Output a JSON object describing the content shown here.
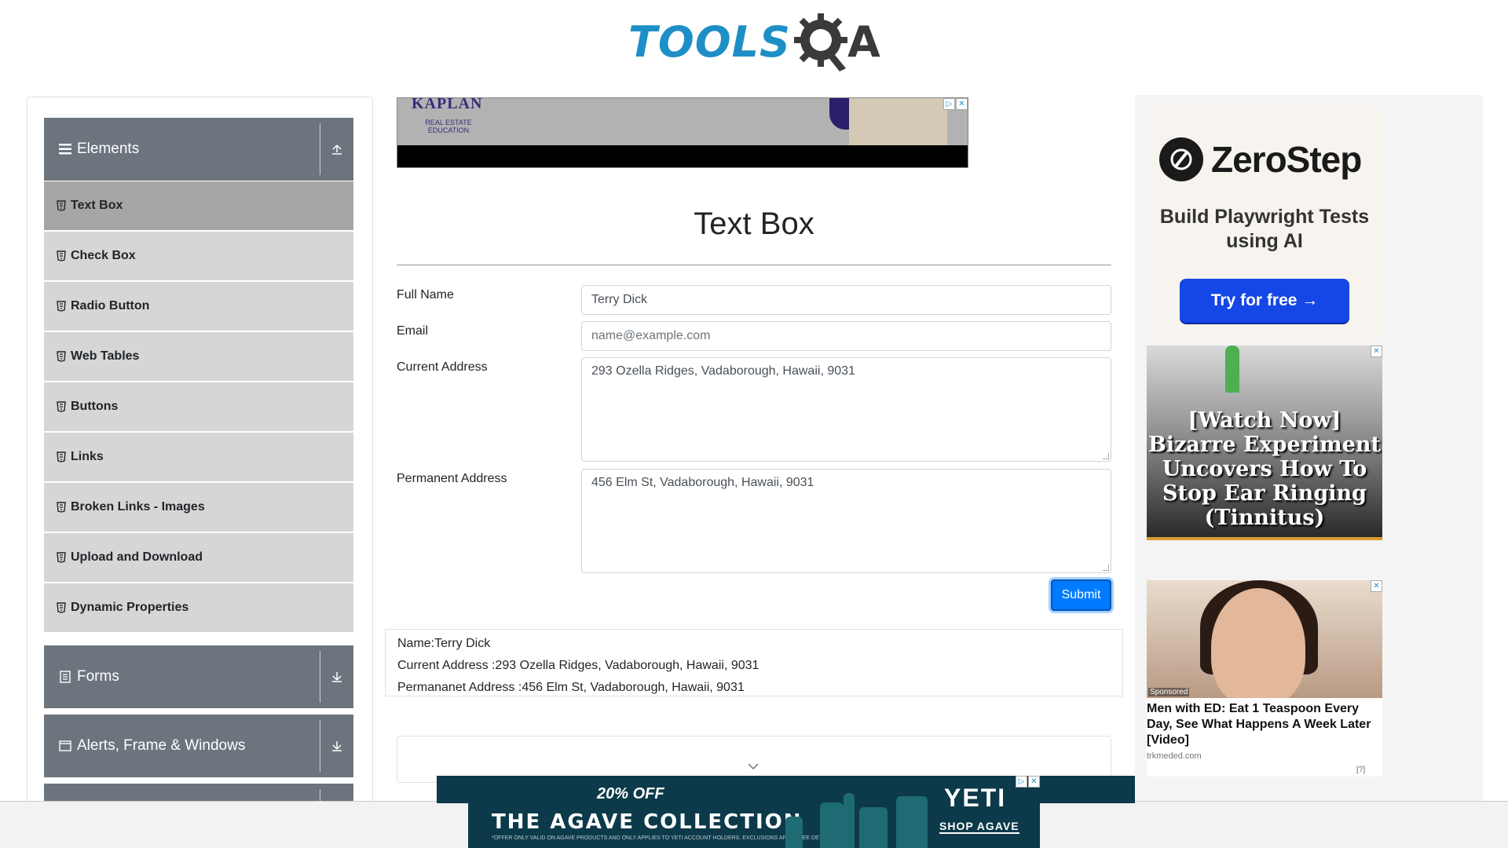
{
  "logo": {
    "text_main": "TOOLS",
    "text_q": "Q",
    "text_a": "A"
  },
  "sidebar": {
    "groups": [
      {
        "label": "Elements",
        "icon": "bars-icon",
        "toggle_icon": "collapse-up-icon"
      },
      {
        "label": "Forms",
        "icon": "form-icon",
        "toggle_icon": "expand-down-icon"
      },
      {
        "label": "Alerts, Frame & Windows",
        "icon": "window-icon",
        "toggle_icon": "expand-down-icon"
      }
    ],
    "items": [
      {
        "label": "Text Box",
        "active": true
      },
      {
        "label": "Check Box"
      },
      {
        "label": "Radio Button"
      },
      {
        "label": "Web Tables"
      },
      {
        "label": "Buttons"
      },
      {
        "label": "Links"
      },
      {
        "label": "Broken Links - Images"
      },
      {
        "label": "Upload and Download"
      },
      {
        "label": "Dynamic Properties"
      }
    ]
  },
  "top_ad": {
    "brand": "KAPLAN",
    "sub": "REAL ESTATE EDUCATION"
  },
  "main": {
    "title": "Text Box",
    "form": {
      "full_name_label": "Full Name",
      "full_name_value": "Terry Dick",
      "email_label": "Email",
      "email_placeholder": "name@example.com",
      "current_address_label": "Current Address",
      "current_address_value": "293 Ozella Ridges, Vadaborough, Hawaii, 9031",
      "permanent_address_label": "Permanent Address",
      "permanent_address_value": "456 Elm St, Vadaborough, Hawaii, 9031",
      "submit_label": "Submit"
    },
    "output": {
      "name": "Name:Terry Dick",
      "current_address": "Current Address :293 Ozella Ridges, Vadaborough, Hawaii, 9031",
      "permanent_address": "Permananet Address :456 Elm St, Vadaborough, Hawaii, 9031"
    }
  },
  "right_ads": {
    "zerostep": {
      "name": "ZeroStep",
      "subtitle": "Build Playwright Tests using AI",
      "button": "Try for free →"
    },
    "tinnitus": {
      "headline": "[Watch Now] Bizarre Experiment Uncovers How To Stop Ear Ringing (Tinnitus)"
    },
    "ed": {
      "sponsored": "Sponsored",
      "headline": "Men with ED: Eat 1 Teaspoon Every Day, See What Happens A Week Later [Video]",
      "source": "trkmeded.com",
      "corner": "[?]"
    }
  },
  "bottom_ad": {
    "offer": "20% OFF",
    "title": "THE AGAVE COLLECTION",
    "fine_print": "*OFFER ONLY VALID ON AGAVE PRODUCTS AND ONLY APPLIES TO YETI ACCOUNT HOLDERS. EXCLUSIONS APPLY. SEE DETAILS.",
    "brand": "YETI",
    "cta": "SHOP AGAVE"
  },
  "colors": {
    "accent": "#007bff",
    "sidebar_header": "#6c757d",
    "menu_item": "#d6d6d6",
    "menu_active": "#a6a6a6",
    "logo_blue": "#1e8fc6"
  }
}
